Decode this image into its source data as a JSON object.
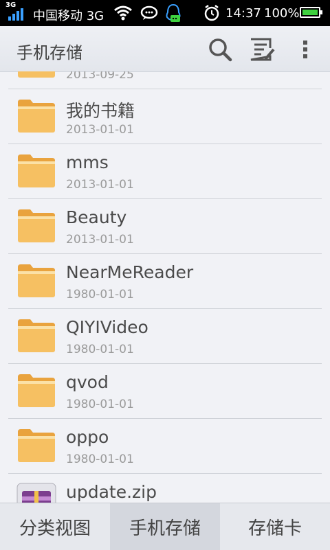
{
  "status_bar": {
    "network_tag": "3G",
    "carrier": "中国移动 3G",
    "time": "14:37",
    "battery": "100%",
    "battery_level": 1.0
  },
  "action_bar": {
    "title": "手机存储",
    "icons": [
      "search-icon",
      "edit-list-icon",
      "overflow-menu-icon"
    ]
  },
  "files": [
    {
      "name": "",
      "date": "2013-09-25",
      "type": "folder"
    },
    {
      "name": "我的书籍",
      "date": "2013-01-01",
      "type": "folder"
    },
    {
      "name": "mms",
      "date": "2013-01-01",
      "type": "folder"
    },
    {
      "name": "Beauty",
      "date": "2013-01-01",
      "type": "folder"
    },
    {
      "name": "NearMeReader",
      "date": "1980-01-01",
      "type": "folder"
    },
    {
      "name": "QIYIVideo",
      "date": "1980-01-01",
      "type": "folder"
    },
    {
      "name": "qvod",
      "date": "1980-01-01",
      "type": "folder"
    },
    {
      "name": "oppo",
      "date": "1980-01-01",
      "type": "folder"
    },
    {
      "name": "update.zip",
      "date": "",
      "type": "archive"
    }
  ],
  "tabs": [
    {
      "label": "分类视图",
      "selected": false
    },
    {
      "label": "手机存储",
      "selected": true
    },
    {
      "label": "存储卡",
      "selected": false
    }
  ],
  "colors": {
    "folder": "#f5b84a",
    "accent_signal": "#3aa0ff",
    "battery": "#3fd23f"
  }
}
